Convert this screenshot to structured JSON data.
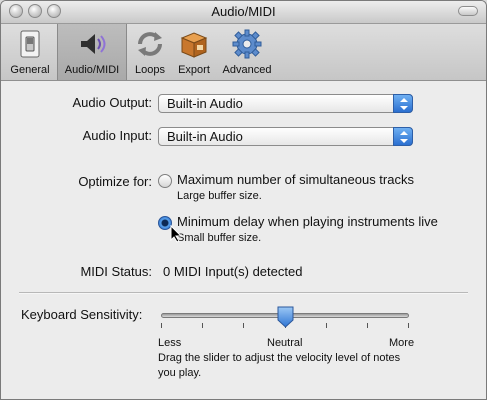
{
  "window": {
    "title": "Audio/MIDI"
  },
  "toolbar": {
    "items": [
      {
        "label": "General",
        "icon": "switch-icon"
      },
      {
        "label": "Audio/MIDI",
        "icon": "speaker-icon",
        "selected": true
      },
      {
        "label": "Loops",
        "icon": "loop-arrows-icon"
      },
      {
        "label": "Export",
        "icon": "box-icon"
      },
      {
        "label": "Advanced",
        "icon": "gear-icon"
      }
    ]
  },
  "audio_output": {
    "label": "Audio Output:",
    "value": "Built-in Audio"
  },
  "audio_input": {
    "label": "Audio Input:",
    "value": "Built-in Audio"
  },
  "optimize": {
    "label": "Optimize for:",
    "options": [
      {
        "label": "Maximum number of simultaneous tracks",
        "note": "Large buffer size.",
        "selected": false
      },
      {
        "label": "Minimum delay when playing instruments live",
        "note": "Small buffer size.",
        "selected": true
      }
    ]
  },
  "midi_status": {
    "label": "MIDI Status:",
    "value": "0 MIDI Input(s) detected"
  },
  "keyboard_sensitivity": {
    "label": "Keyboard Sensitivity:",
    "min_label": "Less",
    "mid_label": "Neutral",
    "max_label": "More",
    "position": 0.5,
    "help_line1": "Drag the slider to adjust the velocity level of notes",
    "help_line2": "you play."
  },
  "colors": {
    "accent": "#2b6fd0",
    "window_bg": "#ececec"
  }
}
